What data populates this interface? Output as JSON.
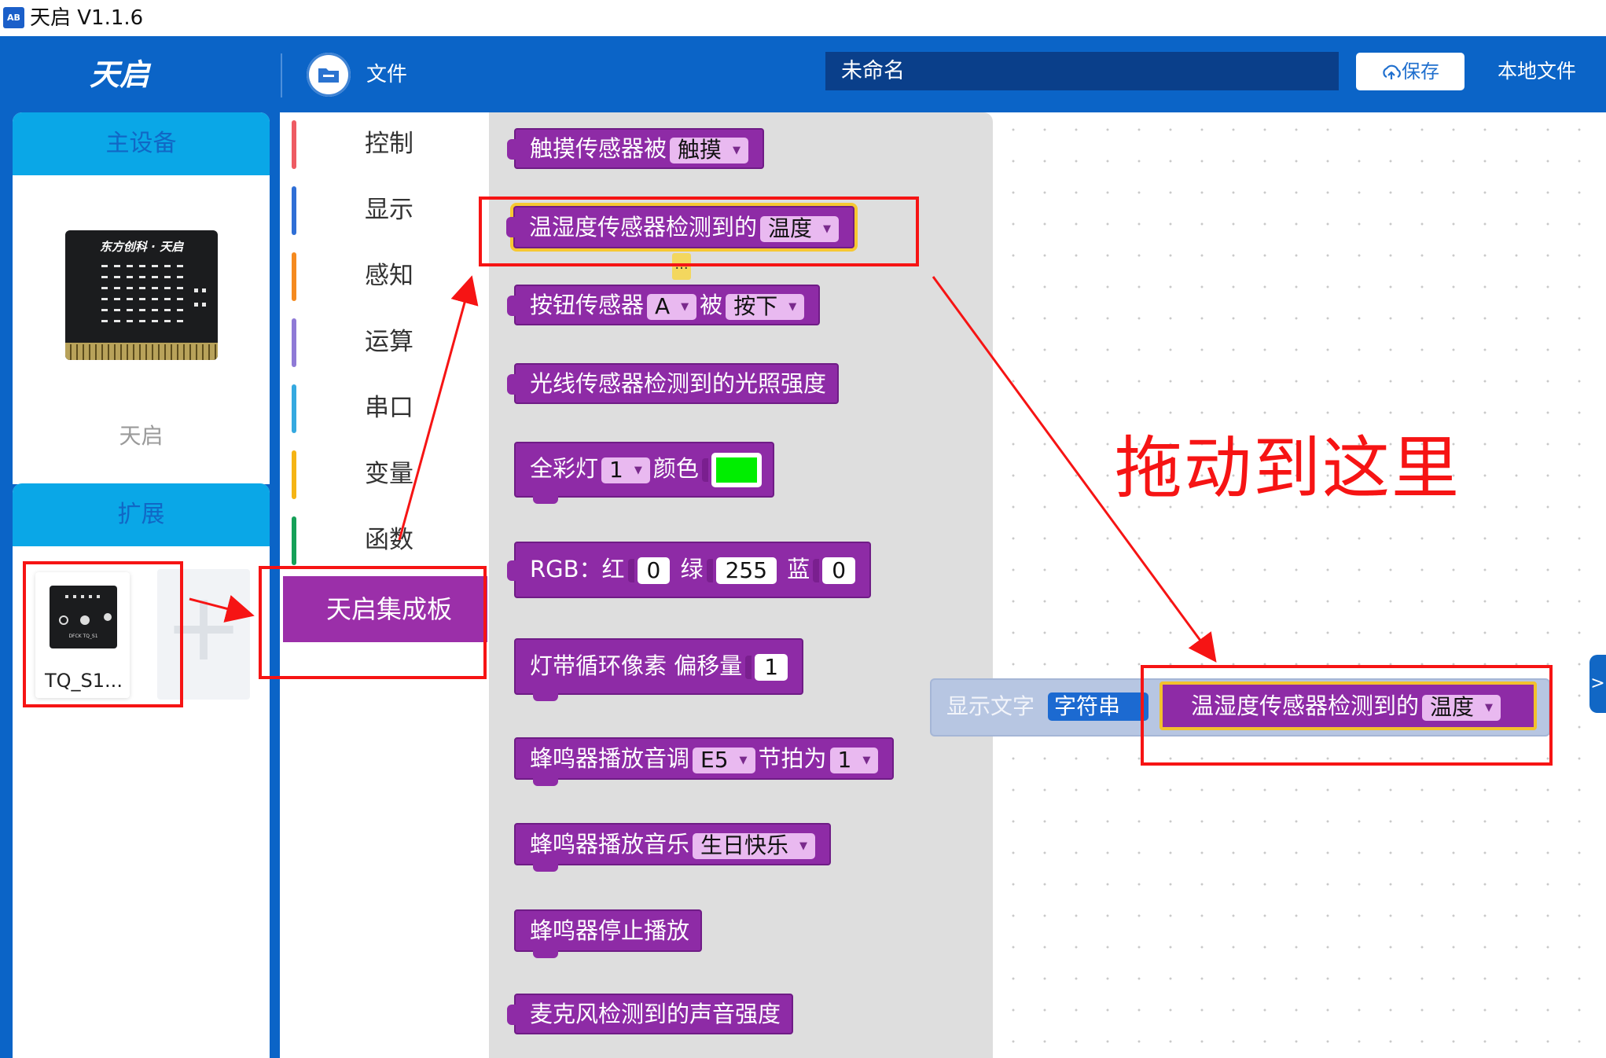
{
  "app": {
    "logo_text": "AB",
    "title": "天启 V1.1.6"
  },
  "header": {
    "brand": "天启",
    "file_icon": "folder-icon",
    "file_label": "文件",
    "project_name": "未命名",
    "save_icon": "cloud-upload-icon",
    "save_label": "保存",
    "local_file_label": "本地文件"
  },
  "sidebar": {
    "main_device_title": "主设备",
    "device_board_text": "东方创科 · 天启",
    "device_name": "天启",
    "extension_title": "扩展",
    "extension_board_text": "DFCK TQ_S1",
    "extension_item": "TQ_S1...",
    "add_symbol": "+"
  },
  "categories": [
    {
      "label": "控制",
      "color": "#ee5b63"
    },
    {
      "label": "显示",
      "color": "#2f6fd6"
    },
    {
      "label": "感知",
      "color": "#f58a1f"
    },
    {
      "label": "运算",
      "color": "#8f7ad6"
    },
    {
      "label": "串口",
      "color": "#35a9e0"
    },
    {
      "label": "变量",
      "color": "#f5b415"
    },
    {
      "label": "函数",
      "color": "#16a058"
    }
  ],
  "active_category": "天启集成板",
  "blocks": {
    "touch": {
      "text": "触摸传感器被",
      "option": "触摸"
    },
    "temp_humidity": {
      "text": "温湿度传感器检测到的",
      "option": "温度"
    },
    "ellipsis": "...",
    "button": {
      "text": "按钮传感器",
      "option1": "A",
      "mid": "被",
      "option2": "按下"
    },
    "light": {
      "text": "光线传感器检测到的光照强度"
    },
    "full_color": {
      "text": "全彩灯",
      "option": "1",
      "mid": "颜色",
      "swatch": "#00ee00"
    },
    "rgb": {
      "text": "RGB：红",
      "red": "0",
      "green_label": "绿",
      "green": "255",
      "blue_label": "蓝",
      "blue": "0"
    },
    "strip": {
      "text": "灯带循环像素 偏移量",
      "value": "1"
    },
    "buzzer_tone": {
      "text": "蜂鸣器播放音调",
      "tone": "E5",
      "mid": "节拍为",
      "beat": "1"
    },
    "buzzer_music": {
      "text": "蜂鸣器播放音乐",
      "option": "生日快乐"
    },
    "buzzer_stop": {
      "text": "蜂鸣器停止播放"
    },
    "mic": {
      "text": "麦克风检测到的声音强度"
    }
  },
  "workspace": {
    "ghost_label": "显示文字",
    "ghost_option": "字符串",
    "drop_text": "温湿度传感器检测到的",
    "drop_option": "温度",
    "expand_arrow": ">"
  },
  "annotation": {
    "callout": "拖动到这里",
    "color": "#f61414"
  }
}
